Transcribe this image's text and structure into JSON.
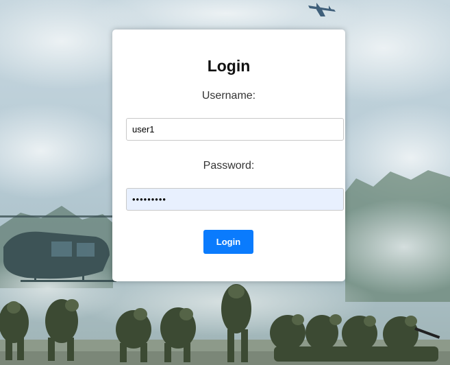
{
  "login": {
    "title": "Login",
    "username_label": "Username:",
    "username_value": "user1",
    "password_label": "Password:",
    "password_value": "•••••••••",
    "submit_label": "Login"
  },
  "colors": {
    "button": "#0a7bfd",
    "autofill_bg": "#e8f0fe"
  }
}
